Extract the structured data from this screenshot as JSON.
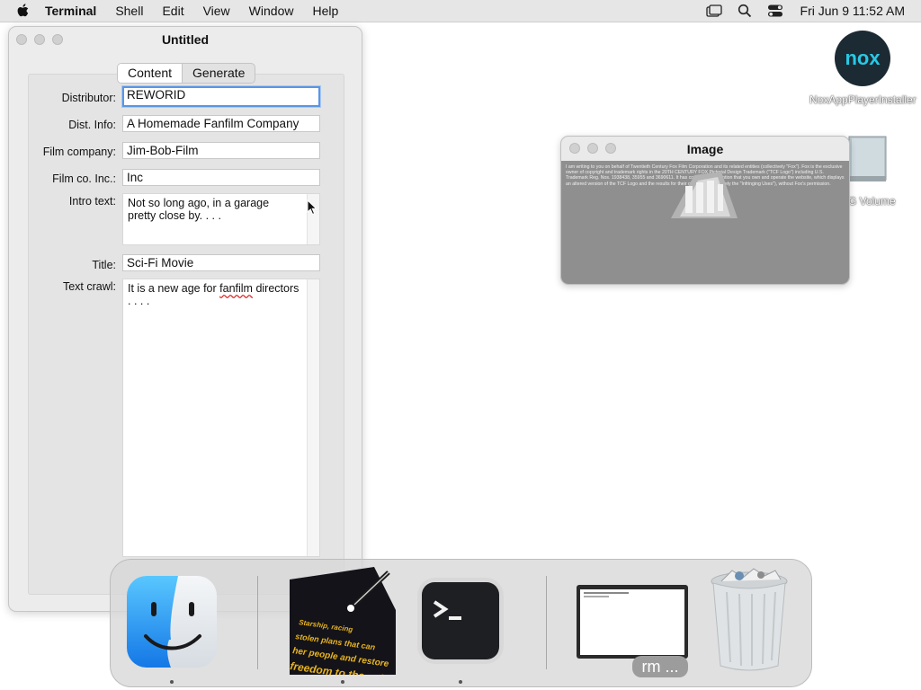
{
  "menubar": {
    "app": "Terminal",
    "items": [
      "Shell",
      "Edit",
      "View",
      "Window",
      "Help"
    ],
    "clock": "Fri Jun 9  11:52 AM"
  },
  "form_window": {
    "title": "Untitled",
    "tabs": [
      {
        "label": "Content",
        "active": true
      },
      {
        "label": "Generate",
        "active": false
      }
    ],
    "fields": {
      "distributor": {
        "label": "Distributor:",
        "value": "REWORID"
      },
      "dist_info": {
        "label": "Dist. Info:",
        "value": "A Homemade Fanfilm Company"
      },
      "film_company": {
        "label": "Film company:",
        "value": "Jim-Bob-Film"
      },
      "film_co_inc": {
        "label": "Film co. Inc.:",
        "value": "Inc"
      },
      "intro_text": {
        "label": "Intro text:",
        "value": "Not so long ago, in a garage pretty close by. . . ."
      },
      "title": {
        "label": "Title:",
        "value": "Sci-Fi Movie"
      },
      "text_crawl": {
        "label": "Text crawl:",
        "value_before": "It is a new age for ",
        "value_misspelled": "fanfilm",
        "value_after": " directors . . . ."
      }
    }
  },
  "image_window": {
    "title": "Image",
    "letter_text": "I am writing to you on behalf of Twentieth Century Fox Film Corporation and its related entities (collectively \"Fox\"). Fox is the exclusive owner of copyright and trademark rights in the 20TH CENTURY FOX Pictorial Design Trademark (\"TCF Logo\") including U.S. Trademark Reg. Nos. 1938438, 35955 and 3690611. It has come to our attention that you own and operate the website, which displays an altered version of the TCF Logo and the results for their own use (collectively the \"Infringing Uses\"), without Fox's permission."
  },
  "desktop": {
    "nox_logo": "nox",
    "nox_label": "NoxAppPlayerInstaller",
    "disk_label": "G Volume"
  },
  "dock": {
    "items": [
      {
        "name": "Finder",
        "icon": "finder-icon",
        "running": true
      },
      {
        "name": "Star Wars Crawl",
        "icon": "crawl-app-icon",
        "running": true
      },
      {
        "name": "Terminal",
        "icon": "terminal-icon",
        "running": true
      },
      {
        "name": "rm ...",
        "icon": "terminal-window-thumbnail",
        "running": false
      },
      {
        "name": "Trash",
        "icon": "trash-icon",
        "running": false
      }
    ],
    "rm_badge": "rm ...",
    "crawl_text": [
      "Starship, racing",
      "stolen plans that can",
      "her people and restore",
      "freedom to the galaxy...."
    ]
  },
  "colors": {
    "menubar_bg": "#e6e6e6",
    "focus_ring": "#5a95e6",
    "image_bg": "#8f8f8f"
  }
}
